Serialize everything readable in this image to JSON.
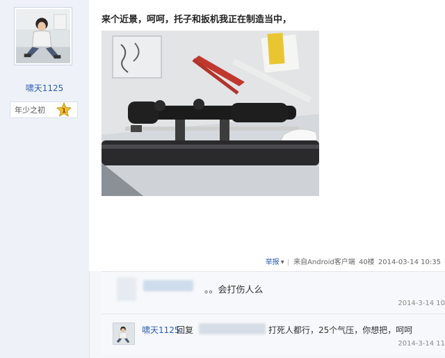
{
  "user": {
    "name": "啸天1125",
    "rank_label": "年少之初",
    "rank_level": "1"
  },
  "post": {
    "text": "来个近景，呵呵，托子和扳机我正在制造当中，",
    "meta": {
      "report": "举报",
      "dropdown_arrow": "▾",
      "source": "来自Android客户端",
      "floor": "40楼",
      "time": "2014-03-14 10:35"
    }
  },
  "replies": [
    {
      "text": "。。会打伤人么",
      "time": "2014-3-14 10"
    },
    {
      "author": "啸天1125:",
      "label": "回复",
      "text": "打死人都行，25个气压，你想把，呵呵",
      "time": "2014-3-14 11"
    }
  ]
}
